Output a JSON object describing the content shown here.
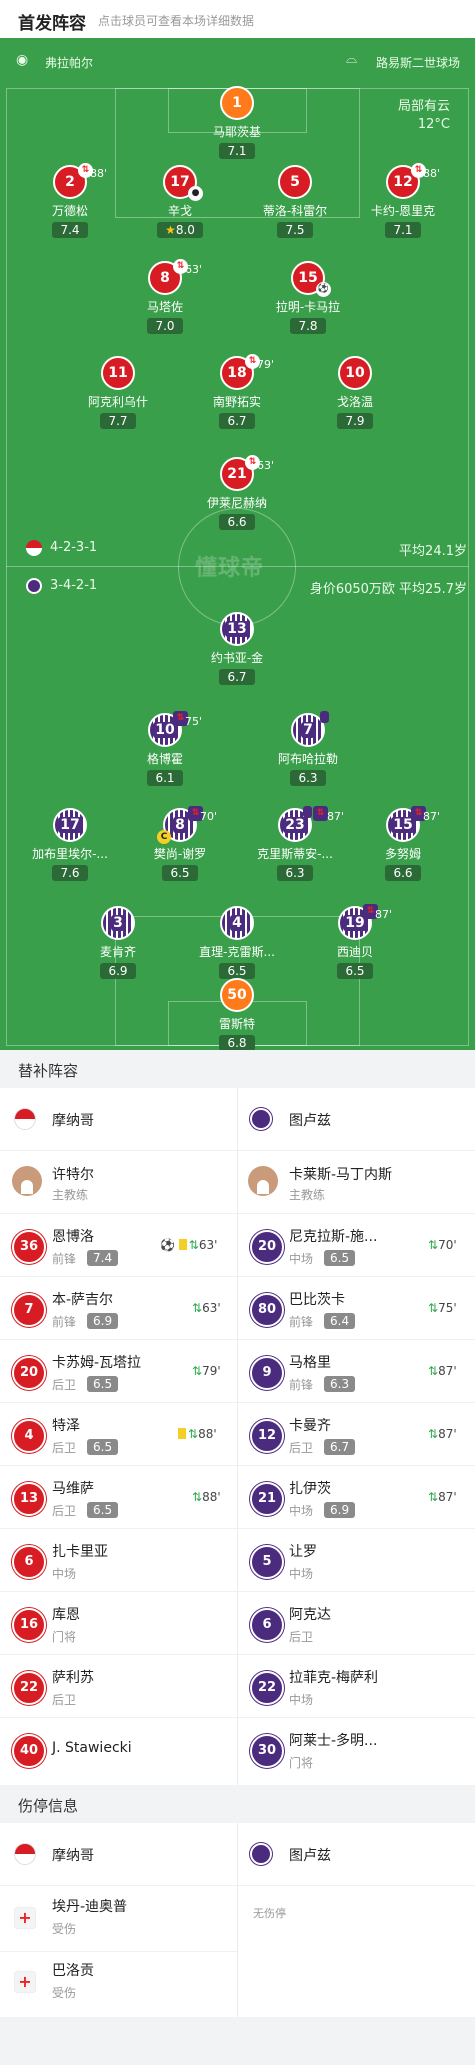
{
  "header": {
    "title": "首发阵容",
    "subtitle": "点击球员可查看本场详细数据"
  },
  "venue": {
    "home_name": "弗拉帕尔",
    "away_name": "路易斯二世球场"
  },
  "weather": {
    "condition": "局部有云",
    "temperature": "12°C"
  },
  "watermark": "懂球帝",
  "home_team": {
    "formation": "4-2-3-1",
    "avg_age": "平均24.1岁"
  },
  "away_team": {
    "formation": "3-4-2-1",
    "value_age": "身价6050万欧 平均25.7岁"
  },
  "lineup_home": [
    {
      "num": "1",
      "name": "马耶茨基",
      "rating": "7.1",
      "kind": "gk"
    },
    {
      "num": "2",
      "name": "万德松",
      "rating": "7.4",
      "minute": "88'"
    },
    {
      "num": "17",
      "name": "辛戈",
      "rating": "8.0"
    },
    {
      "num": "5",
      "name": "蒂洛-科雷尔",
      "rating": "7.5"
    },
    {
      "num": "12",
      "name": "卡约-恩里克",
      "rating": "7.1",
      "minute": "88'"
    },
    {
      "num": "8",
      "name": "马塔佐",
      "rating": "7.0",
      "minute": "63'"
    },
    {
      "num": "15",
      "name": "拉明-卡马拉",
      "rating": "7.8"
    },
    {
      "num": "11",
      "name": "阿克利乌什",
      "rating": "7.7"
    },
    {
      "num": "18",
      "name": "南野拓实",
      "rating": "6.7",
      "minute": "79'"
    },
    {
      "num": "10",
      "name": "戈洛温",
      "rating": "7.9"
    },
    {
      "num": "21",
      "name": "伊莱尼赫纳",
      "rating": "6.6",
      "minute": "63'"
    }
  ],
  "lineup_away": [
    {
      "num": "13",
      "name": "约书亚-金",
      "rating": "6.7"
    },
    {
      "num": "10",
      "name": "格博霍",
      "rating": "6.1",
      "minute": "75'"
    },
    {
      "num": "7",
      "name": "阿布哈拉勒",
      "rating": "6.3"
    },
    {
      "num": "17",
      "name": "加布里埃尔-...",
      "rating": "7.6"
    },
    {
      "num": "8",
      "name": "樊尚-谢罗",
      "rating": "6.5",
      "minute": "70'",
      "captain": "C"
    },
    {
      "num": "23",
      "name": "克里斯蒂安-...",
      "rating": "6.3",
      "minute": "87'"
    },
    {
      "num": "15",
      "name": "多努姆",
      "rating": "6.6",
      "minute": "87'"
    },
    {
      "num": "3",
      "name": "麦肯齐",
      "rating": "6.9"
    },
    {
      "num": "4",
      "name": "直理-克雷斯...",
      "rating": "6.5"
    },
    {
      "num": "19",
      "name": "西迪贝",
      "rating": "6.5",
      "minute": "87'"
    },
    {
      "num": "50",
      "name": "雷斯特",
      "rating": "6.8",
      "kind": "gk"
    }
  ],
  "subs": {
    "title": "替补阵容",
    "home_team": "摩纳哥",
    "away_team": "图卢兹",
    "home_coach": {
      "name": "许特尔",
      "role": "主教练"
    },
    "away_coach": {
      "name": "卡莱斯-马丁内斯",
      "role": "主教练"
    },
    "home": [
      {
        "num": "36",
        "name": "恩博洛",
        "pos": "前锋",
        "rating": "7.4",
        "minute": "63'"
      },
      {
        "num": "7",
        "name": "本-萨吉尔",
        "pos": "前锋",
        "rating": "6.9",
        "minute": "63'"
      },
      {
        "num": "20",
        "name": "卡苏姆-瓦塔拉",
        "pos": "后卫",
        "rating": "6.5",
        "minute": "79'"
      },
      {
        "num": "4",
        "name": "特泽",
        "pos": "后卫",
        "rating": "6.5",
        "minute": "88'"
      },
      {
        "num": "13",
        "name": "马维萨",
        "pos": "后卫",
        "rating": "6.5",
        "minute": "88'"
      },
      {
        "num": "6",
        "name": "扎卡里亚",
        "pos": "中场"
      },
      {
        "num": "16",
        "name": "库恩",
        "pos": "门将"
      },
      {
        "num": "22",
        "name": "萨利苏",
        "pos": "后卫"
      },
      {
        "num": "40",
        "name": "J. Stawiecki",
        "pos": ""
      }
    ],
    "away": [
      {
        "num": "20",
        "name": "尼克拉斯-施...",
        "pos": "中场",
        "rating": "6.5",
        "minute": "70'"
      },
      {
        "num": "80",
        "name": "巴比茨卡",
        "pos": "前锋",
        "rating": "6.4",
        "minute": "75'"
      },
      {
        "num": "9",
        "name": "马格里",
        "pos": "前锋",
        "rating": "6.3",
        "minute": "87'"
      },
      {
        "num": "12",
        "name": "卡曼齐",
        "pos": "后卫",
        "rating": "6.7",
        "minute": "87'"
      },
      {
        "num": "21",
        "name": "扎伊茨",
        "pos": "中场",
        "rating": "6.9",
        "minute": "87'"
      },
      {
        "num": "5",
        "name": "让罗",
        "pos": "中场"
      },
      {
        "num": "6",
        "name": "阿克达",
        "pos": "后卫"
      },
      {
        "num": "22",
        "name": "拉菲克-梅萨利",
        "pos": "中场"
      },
      {
        "num": "30",
        "name": "阿莱士-多明...",
        "pos": "门将"
      }
    ]
  },
  "injuries": {
    "title": "伤停信息",
    "home_team": "摩纳哥",
    "away_team": "图卢兹",
    "home": [
      {
        "name": "埃丹-迪奥普",
        "status": "受伤"
      },
      {
        "name": "巴洛贡",
        "status": "受伤"
      }
    ],
    "away_none": "无伤停"
  },
  "icons": {
    "sub": "sub-in-icon",
    "goal": "ball-icon",
    "yellow": "yellow-card-icon",
    "captain": "captain-icon",
    "star": "star-icon",
    "medical": "medical-icon",
    "whistle": "whistle-icon",
    "stadium": "stadium-icon"
  },
  "colors": {
    "pitch": "#3a9f4a",
    "monaco": "#d71c23",
    "toulouse": "#4b2b7e",
    "goalkeeper": "#ff7a1a",
    "sub_in": "#2ca84a"
  }
}
